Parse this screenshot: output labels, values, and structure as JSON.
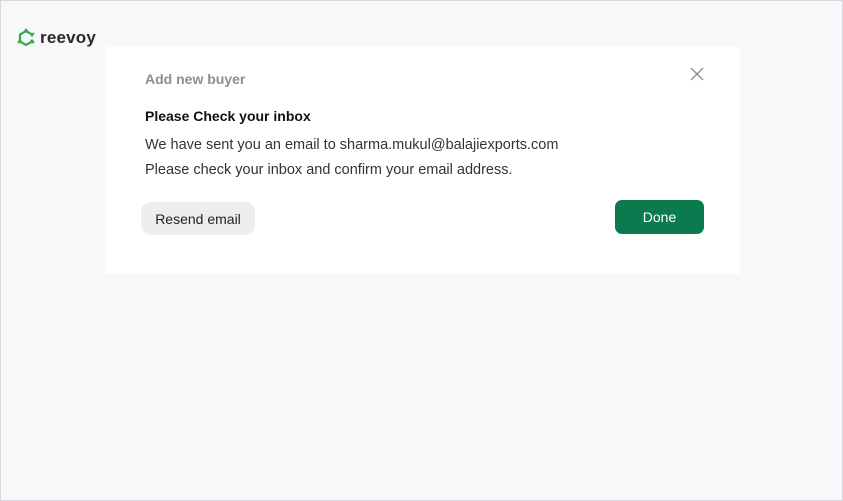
{
  "brand": {
    "name": "reevoy",
    "accent": "#3aa84a",
    "icon": "reevoy-logo-icon"
  },
  "modal": {
    "title": "Add new buyer",
    "close_icon": "close-icon",
    "heading": "Please Check your inbox",
    "line1": "We have sent you an email to sharma.mukul@balajiexports.com",
    "line2": "Please check your inbox and confirm your email address.",
    "resend_label": "Resend email",
    "done_label": "Done",
    "done_color": "#0b7a4f"
  }
}
